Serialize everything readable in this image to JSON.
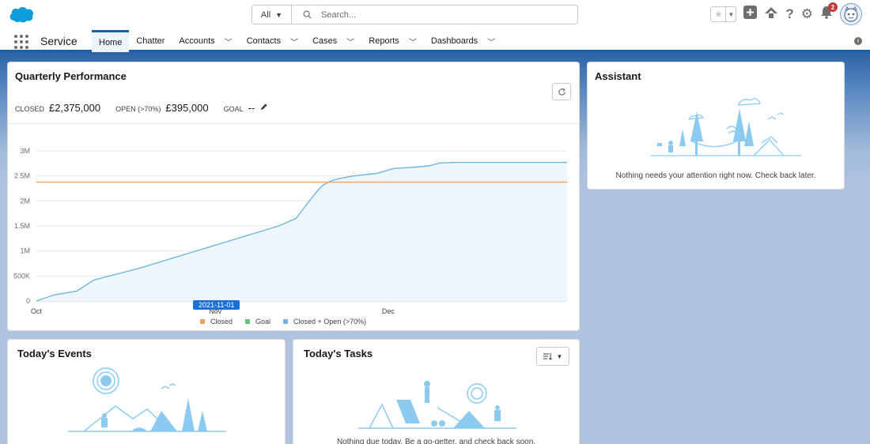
{
  "header": {
    "search_scope": "All",
    "search_placeholder": "Search...",
    "notification_count": "2"
  },
  "nav": {
    "app_name": "Service",
    "tabs": [
      {
        "label": "Home"
      },
      {
        "label": "Chatter"
      },
      {
        "label": "Accounts"
      },
      {
        "label": "Contacts"
      },
      {
        "label": "Cases"
      },
      {
        "label": "Reports"
      },
      {
        "label": "Dashboards"
      }
    ]
  },
  "quarterly": {
    "title": "Quarterly Performance",
    "closed_label": "CLOSED",
    "closed_value": "£2,375,000",
    "open_label": "OPEN (>70%)",
    "open_value": "£395,000",
    "goal_label": "GOAL",
    "goal_value": "--",
    "date_flag": "2021-11-01"
  },
  "chart_data": {
    "type": "area",
    "x_ticks": [
      "Oct",
      "Nov",
      "Dec"
    ],
    "y_ticks": [
      "0",
      "500K",
      "1M",
      "1.5M",
      "2M",
      "2.5M",
      "3M"
    ],
    "ylim": [
      0,
      3000000
    ],
    "xlim": [
      0,
      92
    ],
    "grid": true,
    "legend_position": "bottom",
    "series": [
      {
        "name": "Closed",
        "color": "#f4a25b",
        "values_x": [
          0,
          92
        ],
        "values_y": [
          2375000,
          2375000
        ]
      },
      {
        "name": "Goal",
        "color": "#65c47a",
        "values_x": [],
        "values_y": []
      },
      {
        "name": "Closed + Open (>70%)",
        "color": "#6fb6df",
        "values_x": [
          0,
          3,
          7,
          10,
          18,
          42,
          45,
          46,
          48,
          49.5,
          51,
          53,
          55,
          59,
          62,
          65,
          68,
          70,
          73,
          92
        ],
        "values_y": [
          0,
          120000,
          200000,
          420000,
          660000,
          1500000,
          1650000,
          1800000,
          2100000,
          2300000,
          2400000,
          2460000,
          2500000,
          2550000,
          2650000,
          2670000,
          2700000,
          2760000,
          2770000,
          2770000
        ]
      }
    ]
  },
  "assistant": {
    "title": "Assistant",
    "message": "Nothing needs your attention right now. Check back later."
  },
  "events": {
    "title": "Today's Events"
  },
  "tasks": {
    "title": "Today's Tasks",
    "message": "Nothing due today. Be a go-getter, and check back soon."
  }
}
